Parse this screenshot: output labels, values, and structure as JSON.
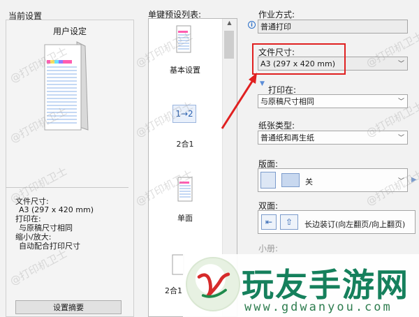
{
  "current_settings": {
    "title": "当前设置",
    "profile_name": "用户设定",
    "summary": [
      {
        "label": "文件尺寸:",
        "value": "A3 (297 x 420 mm)"
      },
      {
        "label": "打印在:",
        "value": "与原稿尺寸相同"
      },
      {
        "label": "缩小/放大:",
        "value": "自动配合打印尺寸"
      }
    ],
    "summary_button": "设置摘要"
  },
  "presets": {
    "title": "单键预设列表:",
    "items": [
      {
        "label": "基本设置",
        "icon": "document-icon"
      },
      {
        "label": "2合1",
        "icon": "two-in-one-icon",
        "icon_text": "1→2"
      },
      {
        "label": "单面",
        "icon": "document-icon"
      },
      {
        "label": "2合1",
        "icon": "document-icon"
      }
    ]
  },
  "settings": {
    "job_type": {
      "label": "作业方式:",
      "value": "普通打印"
    },
    "doc_size": {
      "label": "文件尺寸:",
      "value": "A3 (297 x 420 mm)"
    },
    "print_on": {
      "label": "打印在:",
      "value": "与原稿尺寸相同"
    },
    "paper_type": {
      "label": "纸张类型:",
      "value": "普通纸和再生纸"
    },
    "layout": {
      "label": "版面:",
      "value": "关"
    },
    "duplex": {
      "label": "双面:",
      "value": "长边装订(向左翻页/向上翻页)"
    },
    "booklet": {
      "label": "小册:"
    }
  },
  "watermark": "@打印机卫士",
  "brand": {
    "title": "玩友手游网",
    "url": "www.gdwanyou.com"
  },
  "colors": {
    "highlight": "#e02020",
    "brand_green": "#15805c"
  }
}
